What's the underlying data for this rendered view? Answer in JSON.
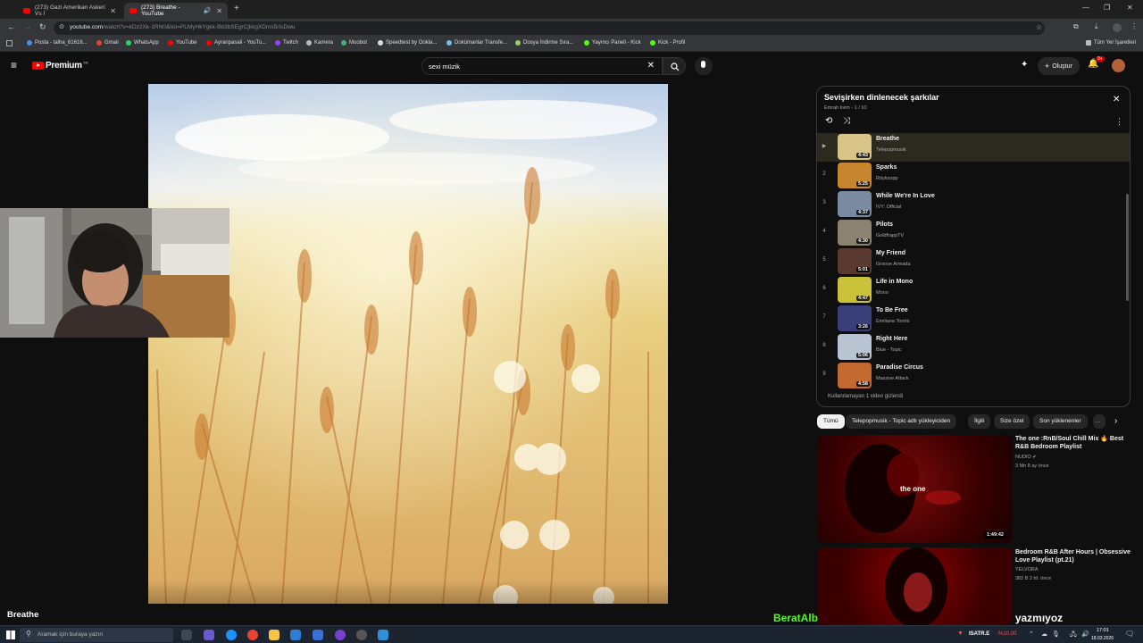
{
  "browser": {
    "tabs": [
      {
        "title": "(273) Gazi Amerikan Askeri Vs İ"
      },
      {
        "title": "(273) Breathe - YouTube"
      }
    ],
    "url_host": "youtube.com",
    "url_rest": "/watch?v=kDz2Xk-1RN0&list=PLMyHkYgkk-Bb3bSEgrCjkkgXDms5rIsDwu",
    "bookmarks": [
      "Posta - talha_61616...",
      "Gmail",
      "WhatsApp",
      "YouTube",
      "Ayranpasali - YouTu...",
      "Twitch",
      "Kamera",
      "Moobot",
      "Speedtest by Ookla...",
      "Dokümanlar Transfe...",
      "Dosya İndirme Sıra...",
      "Yayıncı Paneli - Kick",
      "Kick - Profil"
    ],
    "bookmarks_right": "Tüm Yer İşaretleri"
  },
  "youtube": {
    "logo": "Premium",
    "logo_country": "TR",
    "search_value": "sexi müzik",
    "create_label": "Oluştur",
    "notif_count": "9+"
  },
  "video": {
    "title": "Breathe"
  },
  "playlist": {
    "title": "Sevişirken dinlenecek şarkılar",
    "subtitle": "Emrah Irem - 1 / 10",
    "hidden_note": "Kullanılamayan 1 video gizlendi",
    "items": [
      {
        "idx": "▶",
        "title": "Breathe",
        "channel": "Telepopmusik",
        "duration": "4:43",
        "color": "#d9c488"
      },
      {
        "idx": "2",
        "title": "Sparks",
        "channel": "Röyksopp",
        "duration": "5:25",
        "color": "#c7852d"
      },
      {
        "idx": "3",
        "title": "While We're In Love",
        "channel": "IVY: Official",
        "duration": "4:37",
        "color": "#7a8aa0"
      },
      {
        "idx": "4",
        "title": "Pilots",
        "channel": "GoldfrappTV",
        "duration": "4:30",
        "color": "#8a8372"
      },
      {
        "idx": "5",
        "title": "My Friend",
        "channel": "Groove Armada",
        "duration": "5:01",
        "color": "#5a3a30"
      },
      {
        "idx": "6",
        "title": "Life in Mono",
        "channel": "Mono",
        "duration": "4:47",
        "color": "#c9c23a"
      },
      {
        "idx": "7",
        "title": "To Be Free",
        "channel": "Emiliana Torrini",
        "duration": "3:26",
        "color": "#3a3f7a"
      },
      {
        "idx": "8",
        "title": "Right Here",
        "channel": "Blue - Topic",
        "duration": "5:06",
        "color": "#b8c4d2"
      },
      {
        "idx": "9",
        "title": "Paradise Circus",
        "channel": "Massive Attack",
        "duration": "4:58",
        "color": "#c26a2f"
      }
    ]
  },
  "chips": [
    "Tümü",
    "Telepopmusik - Topic adlı yükleyiciden",
    "İlgili",
    "Size özel",
    "Son yüklenenler"
  ],
  "recommendations": [
    {
      "title": "The one :RnB/Soul Chill Mix 🔥 Best R&B Bedroom Playlist",
      "channel": "NUDIO",
      "meta": "3 Mn  8 ay önce",
      "duration": "1:49:42",
      "thumb_text": "the one"
    },
    {
      "title": "Bedroom R&B After Hours | Obsessive Love Playlist (pt.21)",
      "channel": "YELVORA",
      "meta": "382 B  2 hf. önce",
      "duration": "",
      "thumb_text": ""
    }
  ],
  "chat_overlay": {
    "user": "BeratAlbayraak",
    "message": "sevişmek suç mu oldu ya niye yazmıyoz"
  },
  "taskbar": {
    "search_placeholder": "Aramak için buraya yazın",
    "ticker": "ISATR.E",
    "ticker_change": "-%10.00",
    "time": "17:01",
    "date": "18.03.2026"
  }
}
